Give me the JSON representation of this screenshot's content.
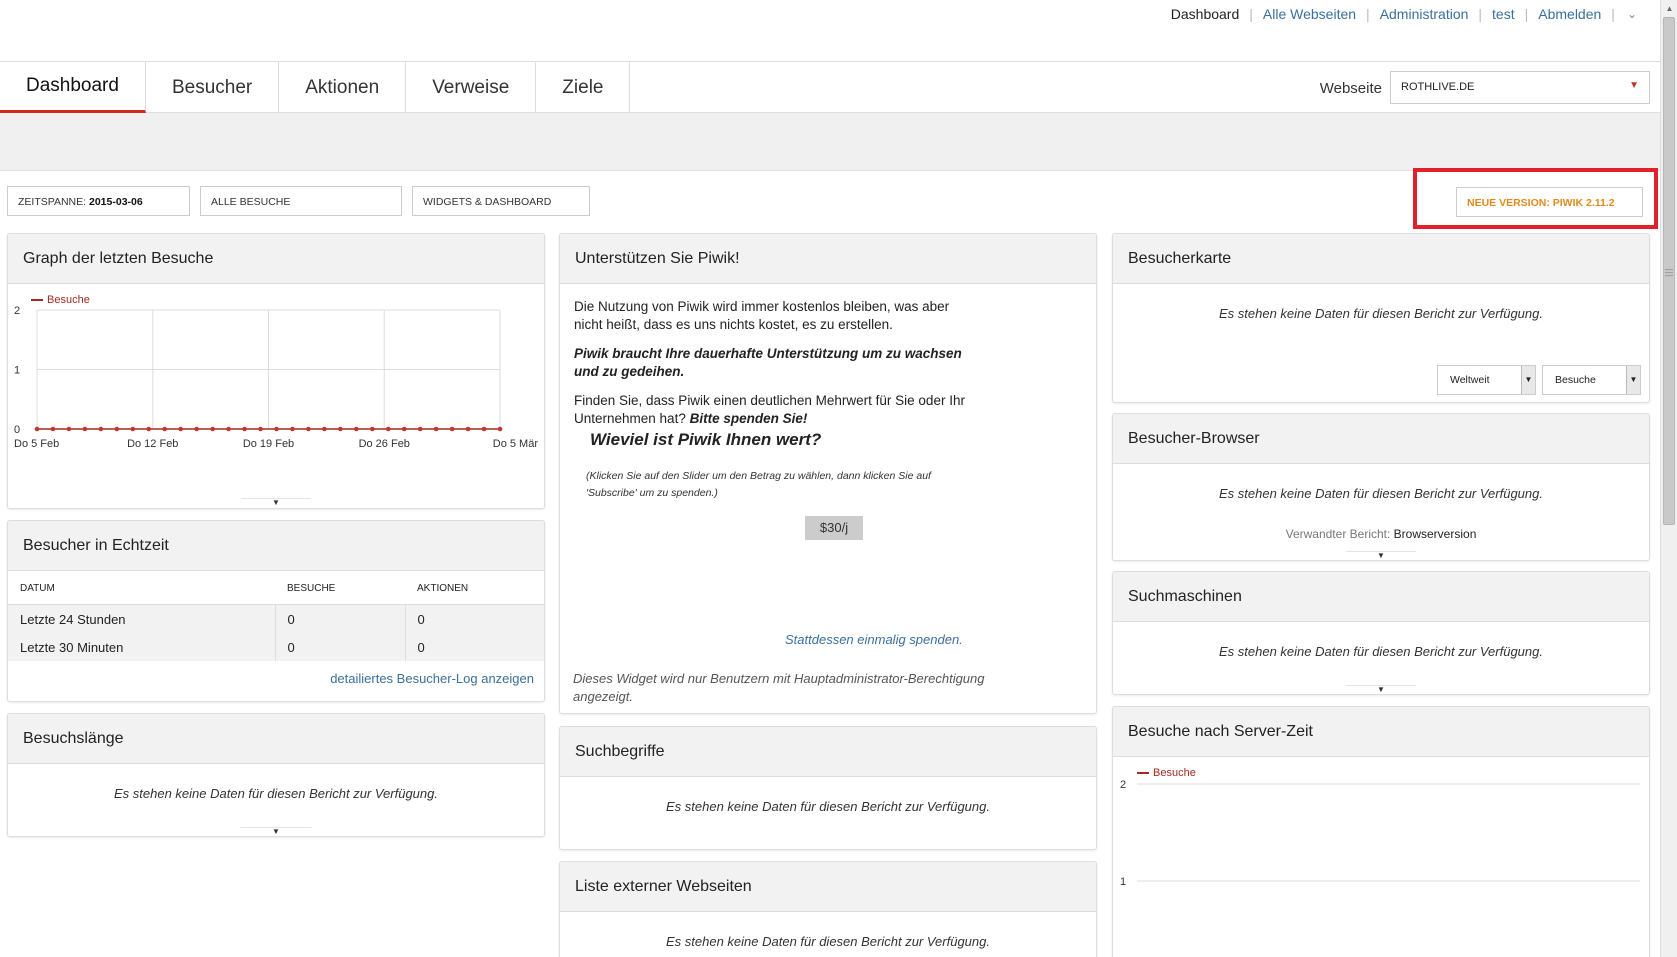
{
  "toplinks": {
    "dashboard": "Dashboard",
    "all_sites": "Alle Webseiten",
    "admin": "Administration",
    "user": "test",
    "logout": "Abmelden"
  },
  "nav": {
    "tabs": [
      "Dashboard",
      "Besucher",
      "Aktionen",
      "Verweise",
      "Ziele"
    ],
    "site_label": "Webseite",
    "site_value": "ROTHLIVE.DE"
  },
  "controls": {
    "period_label": "ZEITSPANNE:",
    "period_value": "2015-03-06",
    "segment": "ALLE BESUCHE",
    "widgets": "WIDGETS & DASHBOARD",
    "new_version": "NEUE VERSION: PIWIK 2.11.2"
  },
  "widgets": {
    "graph": {
      "title": "Graph der letzten Besuche",
      "legend": "Besuche",
      "chart_data": {
        "type": "line",
        "x_ticks": [
          "Do 5 Feb",
          "Do 12 Feb",
          "Do 19 Feb",
          "Do 26 Feb",
          "Do 5 Mär"
        ],
        "y_ticks": [
          "0",
          "1",
          "2"
        ],
        "ylim": [
          0,
          2
        ],
        "series": [
          {
            "name": "Besuche",
            "values": [
              0,
              0,
              0,
              0,
              0,
              0,
              0,
              0,
              0,
              0,
              0,
              0,
              0,
              0,
              0,
              0,
              0,
              0,
              0,
              0,
              0,
              0,
              0,
              0,
              0,
              0,
              0,
              0,
              0,
              0
            ]
          }
        ]
      }
    },
    "realtime": {
      "title": "Besucher in Echtzeit",
      "headers": [
        "DATUM",
        "BESUCHE",
        "AKTIONEN"
      ],
      "rows": [
        [
          "Letzte 24 Stunden",
          "0",
          "0"
        ],
        [
          "Letzte 30 Minuten",
          "0",
          "0"
        ]
      ],
      "link": "detailiertes Besucher-Log anzeigen"
    },
    "length": {
      "title": "Besuchslänge",
      "nodata": "Es stehen keine Daten für diesen Bericht zur Verfügung."
    },
    "support": {
      "title": "Unterstützen Sie Piwik!",
      "p1": "Die Nutzung von Piwik wird immer kostenlos bleiben, was aber nicht heißt, dass es uns nichts kostet, es zu erstellen.",
      "p2": "Piwik braucht Ihre dauerhafte Unterstützung um zu wachsen und zu gedeihen.",
      "p3a": "Finden Sie, dass Piwik einen deutlichen Mehrwert für Sie oder Ihr Unternehmen hat? ",
      "p3b": "Bitte spenden Sie!",
      "big": "Wieviel ist Piwik Ihnen wert?",
      "small": "(Klicken Sie auf den Slider um den Betrag zu wählen, dann klicken Sie auf 'Subscribe' um zu spenden.)",
      "slider_value": "$30/j",
      "once_link": "Stattdessen einmalig spenden.",
      "note": "Dieses Widget wird nur Benutzern mit Hauptadministrator-Berechtigung angezeigt."
    },
    "keywords": {
      "title": "Suchbegriffe",
      "nodata": "Es stehen keine Daten für diesen Bericht zur Verfügung."
    },
    "external": {
      "title": "Liste externer Webseiten",
      "nodata": "Es stehen keine Daten für diesen Bericht zur Verfügung."
    },
    "map": {
      "title": "Besucherkarte",
      "nodata": "Es stehen keine Daten für diesen Bericht zur Verfügung.",
      "region": "Weltweit",
      "metric": "Besuche"
    },
    "browser": {
      "title": "Besucher-Browser",
      "nodata": "Es stehen keine Daten für diesen Bericht zur Verfügung.",
      "related_label": "Verwandter Bericht:",
      "related_value": "Browserversion"
    },
    "search": {
      "title": "Suchmaschinen",
      "nodata": "Es stehen keine Daten für diesen Bericht zur Verfügung."
    },
    "servertime": {
      "title": "Besuche nach Server-Zeit",
      "legend": "Besuche",
      "y_ticks": [
        "2",
        "1"
      ]
    }
  }
}
